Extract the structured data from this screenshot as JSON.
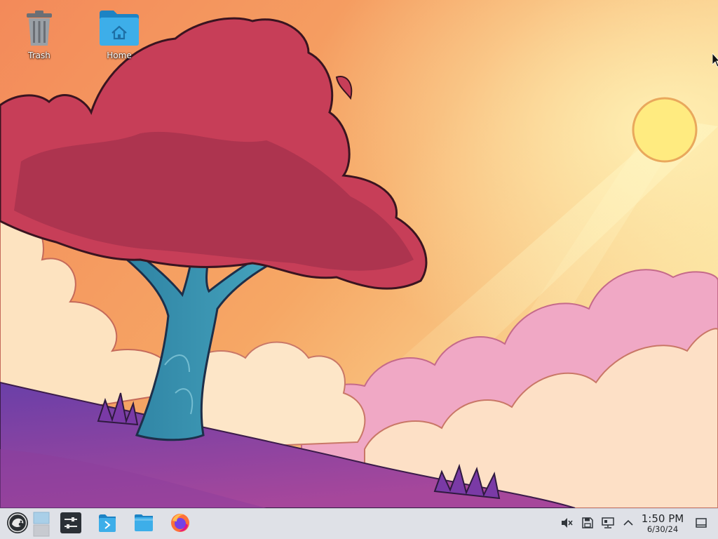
{
  "desktop": {
    "icons": [
      {
        "name": "trash",
        "label": "Trash",
        "icon": "trash-icon"
      },
      {
        "name": "home",
        "label": "Home",
        "icon": "home-folder-icon"
      }
    ]
  },
  "taskbar": {
    "launcher": {
      "icon": "opensuse-logo-icon"
    },
    "pager": {
      "icon": "virtual-desktop-pager"
    },
    "apps": [
      {
        "name": "system-settings",
        "icon": "settings-sliders-icon"
      },
      {
        "name": "discover",
        "icon": "software-center-icon"
      },
      {
        "name": "dolphin",
        "icon": "file-manager-icon"
      },
      {
        "name": "firefox",
        "icon": "firefox-icon"
      }
    ],
    "tray": [
      {
        "name": "volume-muted",
        "icon": "speaker-muted-icon"
      },
      {
        "name": "disks",
        "icon": "floppy-disk-icon"
      },
      {
        "name": "network",
        "icon": "network-wired-icon"
      },
      {
        "name": "expand-tray",
        "icon": "chevron-up-icon"
      }
    ],
    "clock": {
      "time": "1:50 PM",
      "date": "6/30/24"
    },
    "show_desktop": {
      "icon": "show-desktop-icon"
    }
  },
  "colors": {
    "taskbar_bg": "#dfe1e7",
    "folder_blue": "#3daee9",
    "text_dark": "#232629"
  }
}
